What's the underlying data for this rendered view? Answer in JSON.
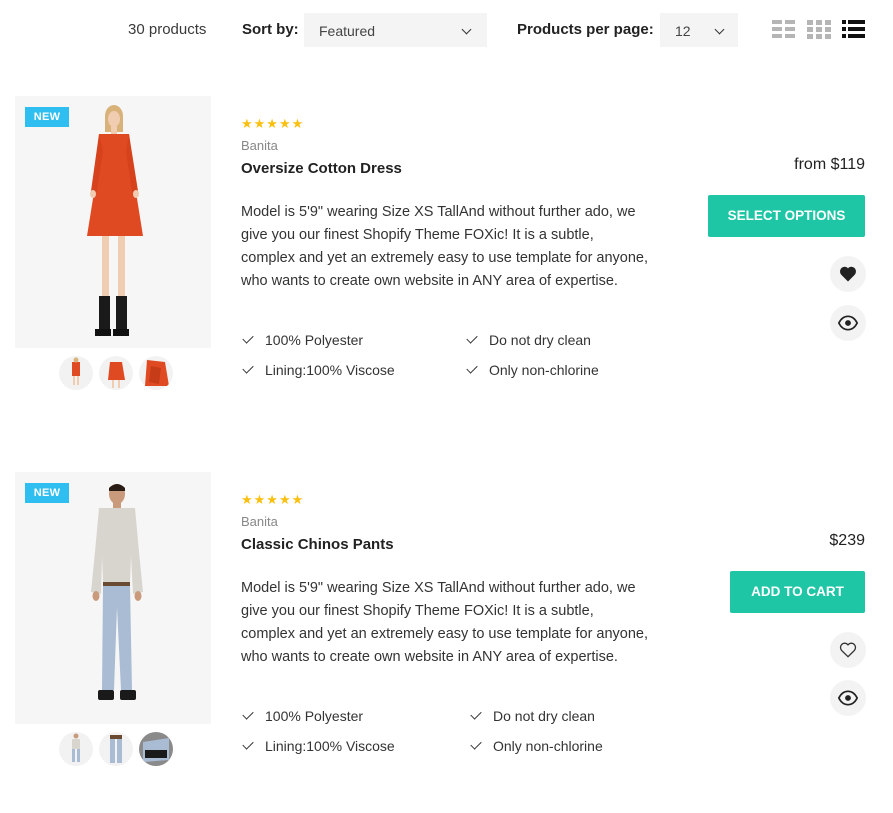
{
  "toolbar": {
    "product_count": "30 products",
    "sort_label": "Sort by:",
    "sort_value": "Featured",
    "per_page_label": "Products per page:",
    "per_page_value": "12",
    "view_icons": [
      "grid-list-icon",
      "grid-small-icon",
      "list-view-icon"
    ]
  },
  "colors": {
    "accent": "#1fc6a6",
    "badge": "#2ebef0",
    "stars": "#fac00f"
  },
  "products": [
    {
      "badge": "NEW",
      "stars": "★★★★★",
      "brand": "Banita",
      "title": "Oversize Cotton Dress",
      "description": "Model is 5'9\" wearing Size XS TallAnd without further ado, we give you our finest Shopify Theme FOXic! It is a subtle, complex and yet an extremely easy to use template for anyone, who wants to create own website in ANY area of expertise.",
      "features": [
        "100% Polyester",
        "Do not dry clean",
        "Lining:100% Viscose",
        "Only non-chlorine"
      ],
      "price": "from $119",
      "button": "SELECT OPTIONS",
      "wishlist_icon": "heart-filled-icon",
      "quickview_icon": "eye-icon"
    },
    {
      "badge": "NEW",
      "stars": "★★★★★",
      "brand": "Banita",
      "title": "Classic Chinos Pants",
      "description": "Model is 5'9\" wearing Size XS TallAnd without further ado, we give you our finest Shopify Theme FOXic! It is a subtle, complex and yet an extremely easy to use template for anyone, who wants to create own website in ANY area of expertise.",
      "features": [
        "100% Polyester",
        "Do not dry clean",
        "Lining:100% Viscose",
        "Only non-chlorine"
      ],
      "price": "$239",
      "button": "ADD TO CART",
      "wishlist_icon": "heart-outline-icon",
      "quickview_icon": "eye-icon"
    }
  ]
}
